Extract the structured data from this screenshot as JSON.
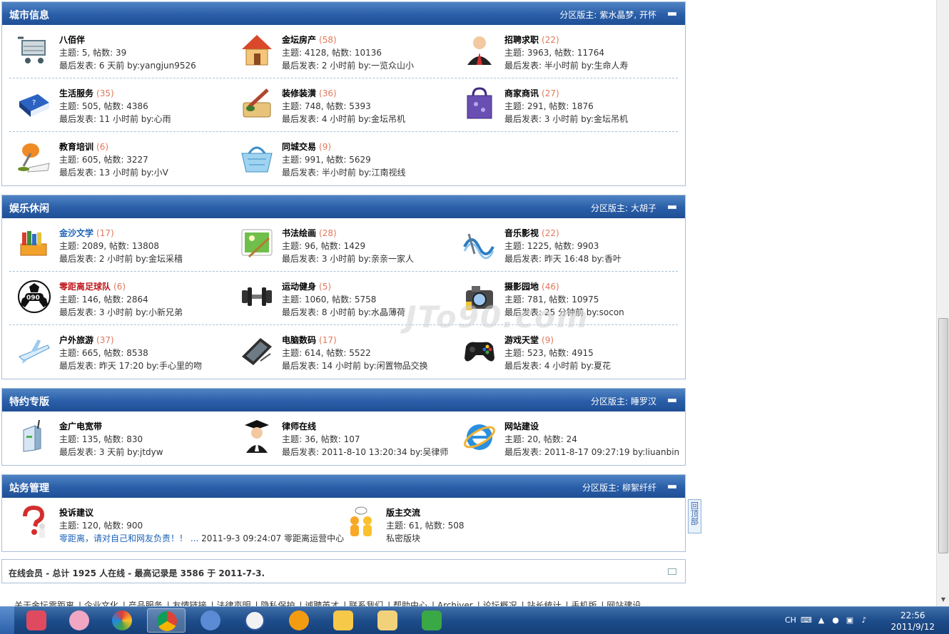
{
  "sections": [
    {
      "title": "城市信息",
      "moderator_label": "分区版主:",
      "moderator": "紫水晶梦, 开怀",
      "rows": [
        [
          {
            "name": "八佰伴",
            "count": "",
            "stats": "主题: 5, 帖数: 39",
            "last": "最后发表: 6 天前 by:yangjun9526",
            "icon": "shopping-cart-icon"
          },
          {
            "name": "金坛房产",
            "count": "(58)",
            "stats": "主题: 4128, 帖数: 10136",
            "last": "最后发表: 2 小时前 by:一览众山小",
            "icon": "house-icon"
          },
          {
            "name": "招聘求职",
            "count": "(22)",
            "stats": "主题: 3963, 帖数: 11764",
            "last": "最后发表: 半小时前 by:生命人寿",
            "icon": "businessman-icon"
          }
        ],
        [
          {
            "name": "生活服务",
            "count": "(35)",
            "stats": "主题: 505, 帖数: 4386",
            "last": "最后发表: 11 小时前 by:心雨",
            "icon": "help-book-icon"
          },
          {
            "name": "装修装潢",
            "count": "(36)",
            "stats": "主题: 748, 帖数: 5393",
            "last": "最后发表: 4 小时前 by:金坛吊机",
            "icon": "paint-brush-icon"
          },
          {
            "name": "商家商讯",
            "count": "(27)",
            "stats": "主题: 291, 帖数: 1876",
            "last": "最后发表: 3 小时前 by:金坛吊机",
            "icon": "shopping-bag-icon"
          }
        ],
        [
          {
            "name": "教育培训",
            "count": "(6)",
            "stats": "主题: 605, 帖数: 3227",
            "last": "最后发表: 13 小时前 by:小V",
            "icon": "desk-lamp-icon"
          },
          {
            "name": "同城交易",
            "count": "(9)",
            "stats": "主题: 991, 帖数: 5629",
            "last": "最后发表: 半小时前 by:江南视线",
            "icon": "basket-icon"
          }
        ]
      ]
    },
    {
      "title": "娱乐休闲",
      "moderator_label": "分区版主:",
      "moderator": "大胡子",
      "rows": [
        [
          {
            "name": "金沙文学",
            "count": "(17)",
            "stats": "主题: 2089, 帖数: 13808",
            "last": "最后发表: 2 小时前 by:金坛采穑",
            "icon": "books-icon",
            "style": "blue"
          },
          {
            "name": "书法绘画",
            "count": "(28)",
            "stats": "主题: 96, 帖数: 1429",
            "last": "最后发表: 3 小时前 by:亲亲一家人",
            "icon": "painting-icon"
          },
          {
            "name": "音乐影视",
            "count": "(22)",
            "stats": "主题: 1225, 帖数: 9903",
            "last": "最后发表: 昨天 16:48 by:香叶",
            "icon": "music-wave-icon"
          }
        ],
        [
          {
            "name": "零距离足球队",
            "count": "(6)",
            "stats": "主题: 146, 帖数: 2864",
            "last": "最后发表: 3 小时前 by:小新兄弟",
            "icon": "soccer-ball-icon",
            "style": "red"
          },
          {
            "name": "运动健身",
            "count": "(5)",
            "stats": "主题: 1060, 帖数: 5758",
            "last": "最后发表: 8 小时前 by:水晶薄荷",
            "icon": "dumbbell-icon"
          },
          {
            "name": "摄影园地",
            "count": "(46)",
            "stats": "主题: 781, 帖数: 10975",
            "last": "最后发表: 25 分钟前 by:socon",
            "icon": "camera-icon"
          }
        ],
        [
          {
            "name": "户外旅游",
            "count": "(37)",
            "stats": "主题: 665, 帖数: 8538",
            "last": "最后发表: 昨天 17:20 by:手心里的吻",
            "icon": "airplane-icon"
          },
          {
            "name": "电脑数码",
            "count": "(17)",
            "stats": "主题: 614, 帖数: 5522",
            "last": "最后发表: 14 小时前 by:闲置物品交换",
            "icon": "tablet-icon"
          },
          {
            "name": "游戏天堂",
            "count": "(9)",
            "stats": "主题: 523, 帖数: 4915",
            "last": "最后发表: 4 小时前 by:夏花",
            "icon": "gamepad-icon"
          }
        ]
      ]
    },
    {
      "title": "特约专版",
      "moderator_label": "分区版主:",
      "moderator": "睡罗汉",
      "rows": [
        [
          {
            "name": "金广电宽带",
            "count": "",
            "stats": "主题: 135, 帖数: 830",
            "last": "最后发表: 3 天前 by:jtdyw",
            "icon": "router-icon"
          },
          {
            "name": "律师在线",
            "count": "",
            "stats": "主题: 36, 帖数: 107",
            "last": "最后发表: 2011-8-10 13:20:34 by:吴律师",
            "icon": "lawyer-icon"
          },
          {
            "name": "网站建设",
            "count": "",
            "stats": "主题: 20, 帖数: 24",
            "last": "最后发表: 2011-8-17 09:27:19 by:liuanbin",
            "icon": "ie-globe-icon"
          }
        ]
      ]
    },
    {
      "title": "站务管理",
      "moderator_label": "分区版主:",
      "moderator": "柳絮纤纤",
      "rows": [
        [
          {
            "name": "投诉建议",
            "count": "",
            "stats": "主题: 120, 帖数: 900",
            "last_link": "零距离，请对自己和网友负责！！ ...",
            "last": "2011-9-3 09:24:07 零距离运营中心",
            "icon": "question-mark-icon"
          },
          {
            "name": "版主交流",
            "count": "",
            "stats": "主题: 61, 帖数: 508",
            "last": "私密版块",
            "icon": "chat-people-icon"
          }
        ]
      ]
    }
  ],
  "online": {
    "label": "在线会员",
    "text_a": " - 总计 ",
    "total": "1925",
    "text_b": " 人在线 - 最高记录是 ",
    "record": "3586",
    "text_c": " 于 ",
    "date": "2011-7-3."
  },
  "footer_links": [
    "关于金坛零距离",
    "企业文化",
    "产品服务",
    "友情链接",
    "法律声明",
    "隐私保护",
    "诚聘英才",
    "联系我们",
    "帮助中心",
    "Archiver",
    "论坛概况",
    "站长统计",
    "手机版",
    "网站建设"
  ],
  "back_to_top": "回顶部",
  "watermark": "JTo90.com",
  "taskbar": {
    "apps": [
      "app-1",
      "app-2",
      "app-3",
      "chrome",
      "app-5",
      "app-6",
      "app-7",
      "app-8",
      "app-9",
      "app-10"
    ],
    "lang": "CH",
    "time": "22:56",
    "date": "2011/9/12"
  },
  "colors": {
    "header_blue": "#2a5ea8",
    "count_orange": "#e0785a",
    "link_blue": "#1a62b8",
    "name_red": "#c0171c"
  }
}
